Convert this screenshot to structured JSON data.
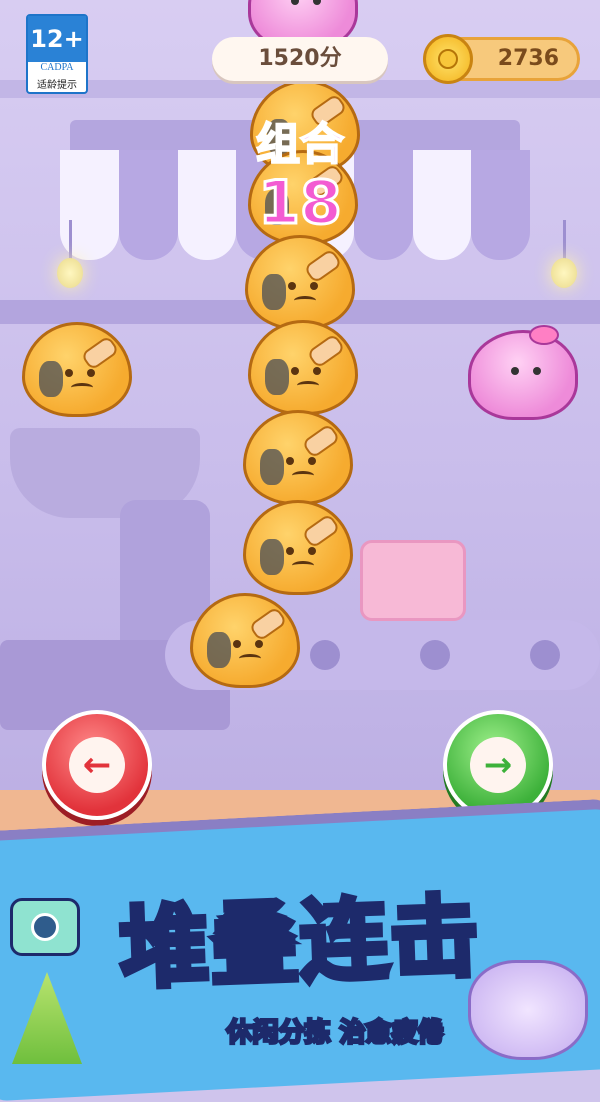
{
  "hud": {
    "age_rating": {
      "number": "12+",
      "org": "CADPA",
      "caption": "适龄提示"
    },
    "score": "1520分",
    "coins": "2736"
  },
  "combo": {
    "label": "组合",
    "count": "18"
  },
  "banner": {
    "title": "堆叠连击",
    "subtitle": "休闲分拣  治愈疲倦"
  },
  "controls": {
    "left_icon": "arrow-left-icon",
    "right_icon": "arrow-right-icon"
  },
  "colors": {
    "combo": "#f35bd2",
    "left_button": "#e2333b",
    "right_button": "#3db13a",
    "banner": "#59b8ef"
  }
}
